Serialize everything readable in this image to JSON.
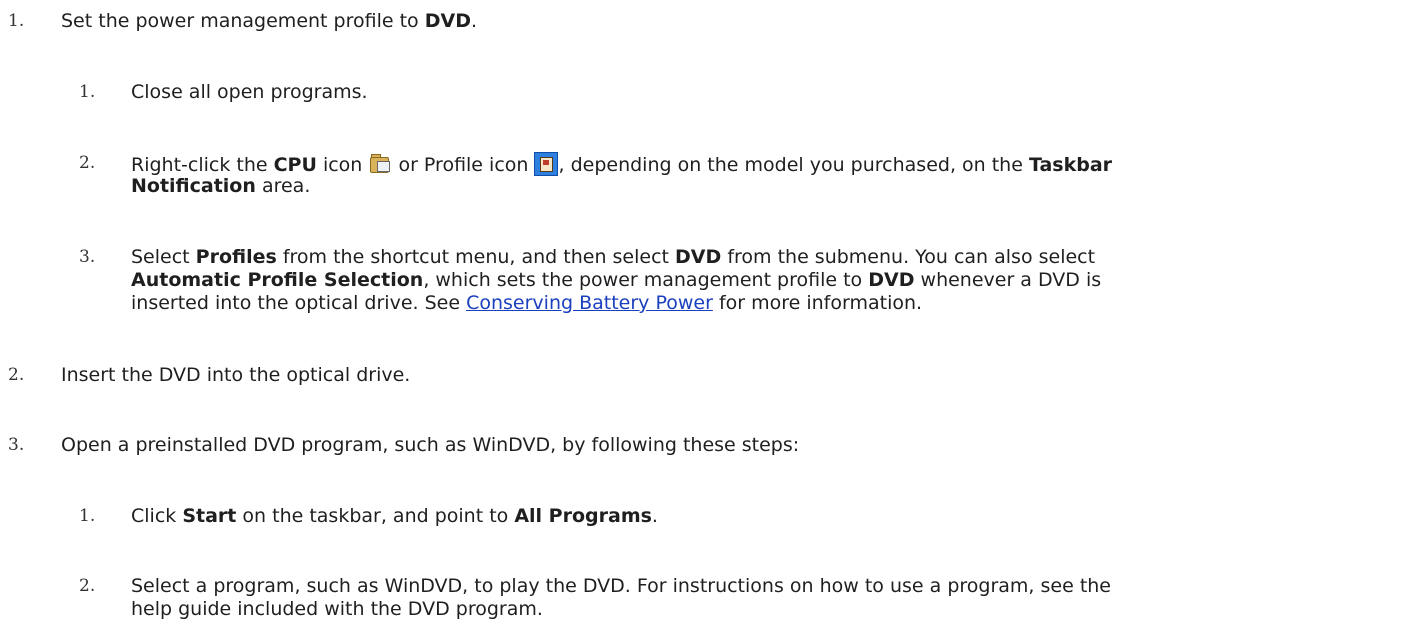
{
  "steps": [
    {
      "num": "1.",
      "text_pre": "Set the power management profile to ",
      "text_bold": "DVD",
      "text_post": ".",
      "substeps": [
        {
          "num": "1.",
          "text": "Close all open programs."
        },
        {
          "num": "2.",
          "t1": "Right-click the ",
          "b1": "CPU",
          "t2": " icon ",
          "t3": " or Profile icon ",
          "t4": ", depending on the model you purchased, on the ",
          "b2": "Taskbar",
          "b3": "Notification",
          "t5": " area."
        },
        {
          "num": "3.",
          "t1": "Select ",
          "b1": "Profiles",
          "t2": " from the shortcut menu, and then select ",
          "b2": "DVD",
          "t3": " from the submenu. You can also select",
          "b3": "Automatic Profile Selection",
          "t4": ", which sets the power management profile to ",
          "b4": "DVD",
          "t5": " whenever a DVD is",
          "t6": "inserted into the optical drive. See ",
          "link": "Conserving Battery Power",
          "t7": " for more information."
        }
      ]
    },
    {
      "num": "2.",
      "text": "Insert the DVD into the optical drive."
    },
    {
      "num": "3.",
      "text": "Open a preinstalled DVD program, such as WinDVD, by following these steps:",
      "substeps": [
        {
          "num": "1.",
          "t1": "Click ",
          "b1": "Start",
          "t2": " on the taskbar, and point to ",
          "b2": "All Programs",
          "t3": "."
        },
        {
          "num": "2.",
          "line1": "Select a program, such as WinDVD, to play the DVD. For instructions on how to use a program, see the",
          "line2": "help guide included with the DVD program."
        }
      ]
    }
  ]
}
